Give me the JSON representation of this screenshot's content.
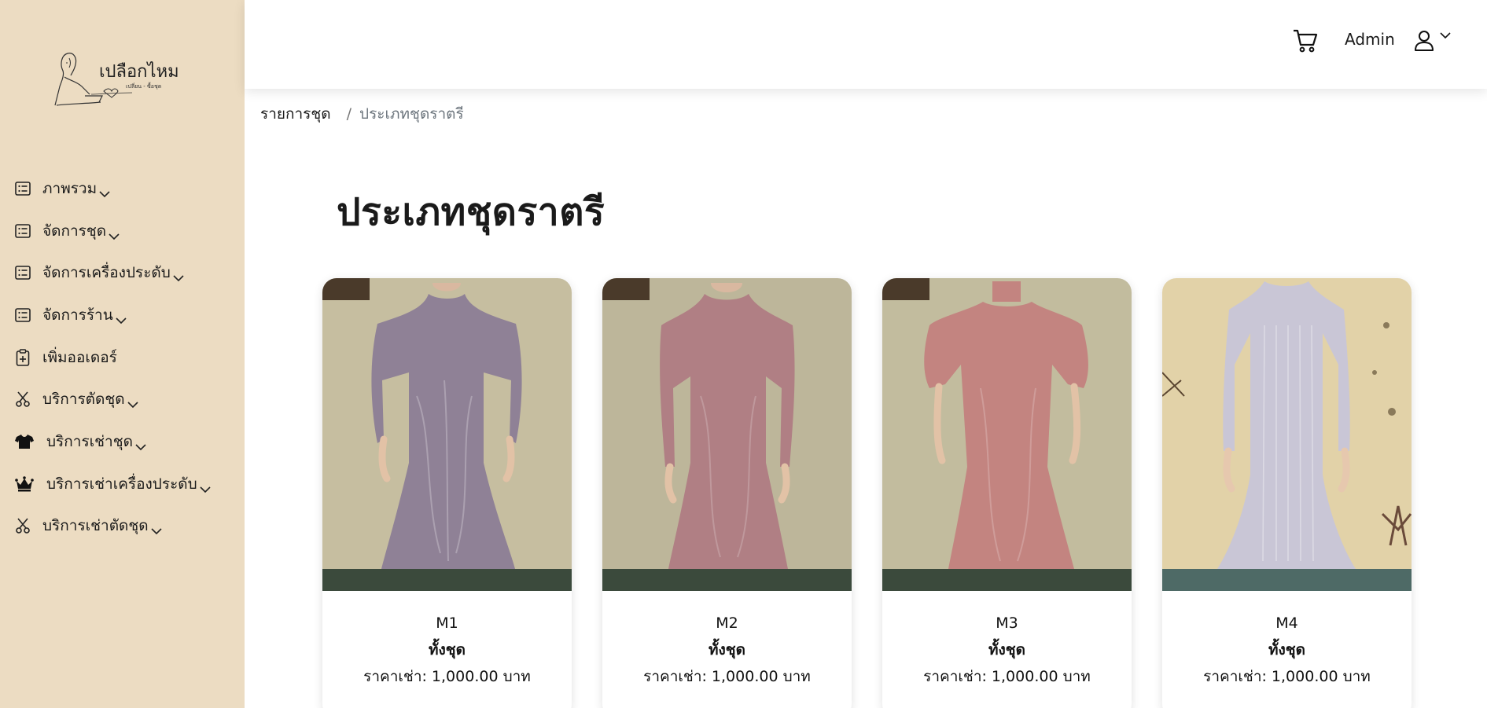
{
  "brand": {
    "logo_text": "เปลือกไหม",
    "logo_subtext": "เปลี่ยน - ซื้อชุด"
  },
  "sidebar": {
    "items": [
      {
        "label": "ภาพรวม",
        "icon": "list-icon",
        "has_dropdown": true
      },
      {
        "label": "จัดการชุด",
        "icon": "list-icon",
        "has_dropdown": true
      },
      {
        "label": "จัดการเครื่องประดับ",
        "icon": "list-icon",
        "has_dropdown": true
      },
      {
        "label": "จัดการร้าน",
        "icon": "list-icon",
        "has_dropdown": true
      },
      {
        "label": "เพิ่มออเดอร์",
        "icon": "clipboard-plus-icon",
        "has_dropdown": false
      },
      {
        "label": "บริการตัดชุด",
        "icon": "scissors-icon",
        "has_dropdown": true
      },
      {
        "label": "บริการเช่าชุด",
        "icon": "tshirt-icon",
        "has_dropdown": true
      },
      {
        "label": "บริการเช่าเครื่องประดับ",
        "icon": "crown-icon",
        "has_dropdown": true
      },
      {
        "label": "บริการเช่าตัดชุด",
        "icon": "scissors-icon",
        "has_dropdown": true
      }
    ]
  },
  "header": {
    "user_name": "Admin",
    "cart_icon": "cart-icon",
    "user_icon": "user-icon"
  },
  "breadcrumb": {
    "parent": "รายการชุด",
    "separator": "/",
    "current": "ประเภทชุดราตรี"
  },
  "page": {
    "title": "ประเภทชุดราตรี"
  },
  "products": [
    {
      "code": "M1",
      "category": "ทั้งชุด",
      "price": "ราคาเช่า: 1,000.00 บาท",
      "dress_color": "#8f8196",
      "wall_color": "#c6bea0"
    },
    {
      "code": "M2",
      "category": "ทั้งชุด",
      "price": "ราคาเช่า: 1,000.00 บาท",
      "dress_color": "#b07f84",
      "wall_color": "#bdb69a"
    },
    {
      "code": "M3",
      "category": "ทั้งชุด",
      "price": "ราคาเช่า: 1,000.00 บาท",
      "dress_color": "#c38480",
      "wall_color": "#c2bc9e"
    },
    {
      "code": "M4",
      "category": "ทั้งชุด",
      "price": "ราคาเช่า: 1,000.00 บาท",
      "dress_color": "#c9c6d6",
      "wall_color": "#e2d2a8"
    }
  ],
  "colors": {
    "sidebar_bg": "#ecdcc2",
    "text": "#1a1a1a",
    "muted": "#6c757d"
  }
}
